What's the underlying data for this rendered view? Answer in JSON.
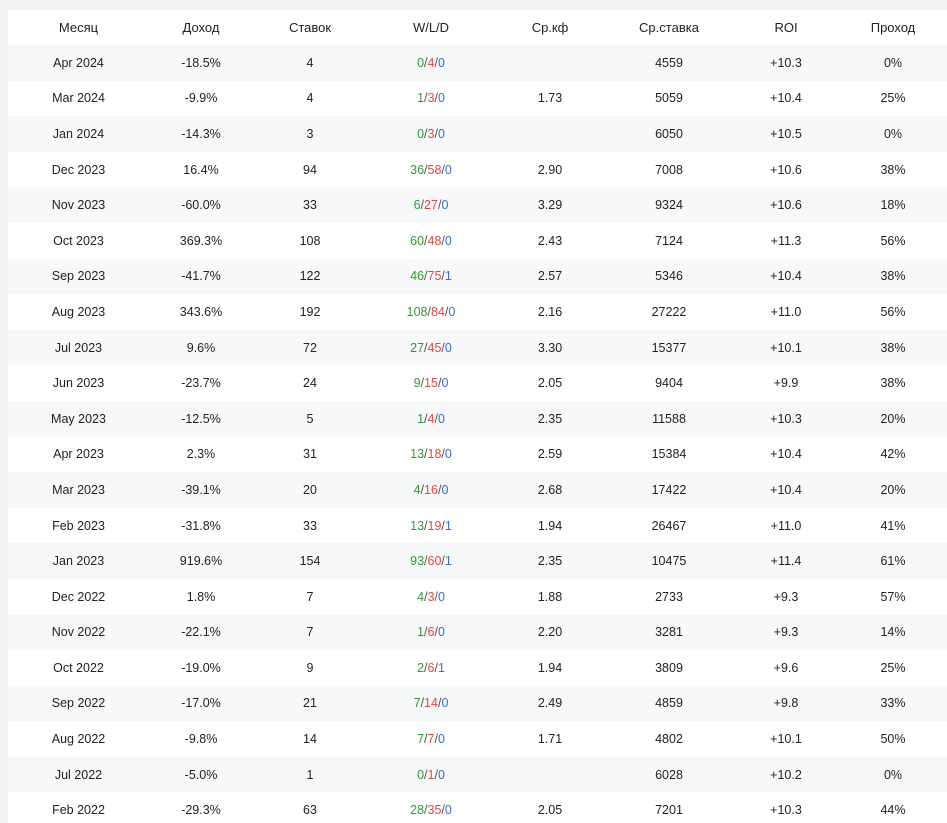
{
  "headers": {
    "month": "Месяц",
    "income": "Доход",
    "bets": "Ставок",
    "wld": "W/L/D",
    "avg_kf": "Ср.кф",
    "avg_bet": "Ср.ставка",
    "roi": "ROI",
    "pass": "Проход"
  },
  "colors": {
    "positive": "#2e9d2e",
    "negative": "#e04848",
    "draw": "#2f6fd6",
    "row_stripe": "#f7f8fa"
  },
  "rows": [
    {
      "month": "Apr 2024",
      "income": "-18.5%",
      "bets": "4",
      "w": "0",
      "l": "4",
      "d": "0",
      "kf": "",
      "avg": "4559",
      "roi": "+10.3",
      "pass": "0%",
      "pass_tone": "neu"
    },
    {
      "month": "Mar 2024",
      "income": "-9.9%",
      "bets": "4",
      "w": "1",
      "l": "3",
      "d": "0",
      "kf": "1.73",
      "avg": "5059",
      "roi": "+10.4",
      "pass": "25%",
      "pass_tone": "neg"
    },
    {
      "month": "Jan 2024",
      "income": "-14.3%",
      "bets": "3",
      "w": "0",
      "l": "3",
      "d": "0",
      "kf": "",
      "avg": "6050",
      "roi": "+10.5",
      "pass": "0%",
      "pass_tone": "neu"
    },
    {
      "month": "Dec 2023",
      "income": "16.4%",
      "bets": "94",
      "w": "36",
      "l": "58",
      "d": "0",
      "kf": "2.90",
      "avg": "7008",
      "roi": "+10.6",
      "pass": "38%",
      "pass_tone": "neg"
    },
    {
      "month": "Nov 2023",
      "income": "-60.0%",
      "bets": "33",
      "w": "6",
      "l": "27",
      "d": "0",
      "kf": "3.29",
      "avg": "9324",
      "roi": "+10.6",
      "pass": "18%",
      "pass_tone": "neg"
    },
    {
      "month": "Oct 2023",
      "income": "369.3%",
      "bets": "108",
      "w": "60",
      "l": "48",
      "d": "0",
      "kf": "2.43",
      "avg": "7124",
      "roi": "+11.3",
      "pass": "56%",
      "pass_tone": "blue"
    },
    {
      "month": "Sep 2023",
      "income": "-41.7%",
      "bets": "122",
      "w": "46",
      "l": "75",
      "d": "1",
      "kf": "2.57",
      "avg": "5346",
      "roi": "+10.4",
      "pass": "38%",
      "pass_tone": "neg"
    },
    {
      "month": "Aug 2023",
      "income": "343.6%",
      "bets": "192",
      "w": "108",
      "l": "84",
      "d": "0",
      "kf": "2.16",
      "avg": "27222",
      "roi": "+11.0",
      "pass": "56%",
      "pass_tone": "blue"
    },
    {
      "month": "Jul 2023",
      "income": "9.6%",
      "bets": "72",
      "w": "27",
      "l": "45",
      "d": "0",
      "kf": "3.30",
      "avg": "15377",
      "roi": "+10.1",
      "pass": "38%",
      "pass_tone": "neg"
    },
    {
      "month": "Jun 2023",
      "income": "-23.7%",
      "bets": "24",
      "w": "9",
      "l": "15",
      "d": "0",
      "kf": "2.05",
      "avg": "9404",
      "roi": "+9.9",
      "pass": "38%",
      "pass_tone": "neg"
    },
    {
      "month": "May 2023",
      "income": "-12.5%",
      "bets": "5",
      "w": "1",
      "l": "4",
      "d": "0",
      "kf": "2.35",
      "avg": "11588",
      "roi": "+10.3",
      "pass": "20%",
      "pass_tone": "neg"
    },
    {
      "month": "Apr 2023",
      "income": "2.3%",
      "bets": "31",
      "w": "13",
      "l": "18",
      "d": "0",
      "kf": "2.59",
      "avg": "15384",
      "roi": "+10.4",
      "pass": "42%",
      "pass_tone": "neg"
    },
    {
      "month": "Mar 2023",
      "income": "-39.1%",
      "bets": "20",
      "w": "4",
      "l": "16",
      "d": "0",
      "kf": "2.68",
      "avg": "17422",
      "roi": "+10.4",
      "pass": "20%",
      "pass_tone": "neg"
    },
    {
      "month": "Feb 2023",
      "income": "-31.8%",
      "bets": "33",
      "w": "13",
      "l": "19",
      "d": "1",
      "kf": "1.94",
      "avg": "26467",
      "roi": "+11.0",
      "pass": "41%",
      "pass_tone": "neg"
    },
    {
      "month": "Jan 2023",
      "income": "919.6%",
      "bets": "154",
      "w": "93",
      "l": "60",
      "d": "1",
      "kf": "2.35",
      "avg": "10475",
      "roi": "+11.4",
      "pass": "61%",
      "pass_tone": "blue"
    },
    {
      "month": "Dec 2022",
      "income": "1.8%",
      "bets": "7",
      "w": "4",
      "l": "3",
      "d": "0",
      "kf": "1.88",
      "avg": "2733",
      "roi": "+9.3",
      "pass": "57%",
      "pass_tone": "blue"
    },
    {
      "month": "Nov 2022",
      "income": "-22.1%",
      "bets": "7",
      "w": "1",
      "l": "6",
      "d": "0",
      "kf": "2.20",
      "avg": "3281",
      "roi": "+9.3",
      "pass": "14%",
      "pass_tone": "neg"
    },
    {
      "month": "Oct 2022",
      "income": "-19.0%",
      "bets": "9",
      "w": "2",
      "l": "6",
      "d": "1",
      "kf": "1.94",
      "avg": "3809",
      "roi": "+9.6",
      "pass": "25%",
      "pass_tone": "neg"
    },
    {
      "month": "Sep 2022",
      "income": "-17.0%",
      "bets": "21",
      "w": "7",
      "l": "14",
      "d": "0",
      "kf": "2.49",
      "avg": "4859",
      "roi": "+9.8",
      "pass": "33%",
      "pass_tone": "neg"
    },
    {
      "month": "Aug 2022",
      "income": "-9.8%",
      "bets": "14",
      "w": "7",
      "l": "7",
      "d": "0",
      "kf": "1.71",
      "avg": "4802",
      "roi": "+10.1",
      "pass": "50%",
      "pass_tone": "neg"
    },
    {
      "month": "Jul 2022",
      "income": "-5.0%",
      "bets": "1",
      "w": "0",
      "l": "1",
      "d": "0",
      "kf": "",
      "avg": "6028",
      "roi": "+10.2",
      "pass": "0%",
      "pass_tone": "neu"
    },
    {
      "month": "Feb 2022",
      "income": "-29.3%",
      "bets": "63",
      "w": "28",
      "l": "35",
      "d": "0",
      "kf": "2.05",
      "avg": "7201",
      "roi": "+10.3",
      "pass": "44%",
      "pass_tone": "neg"
    }
  ]
}
